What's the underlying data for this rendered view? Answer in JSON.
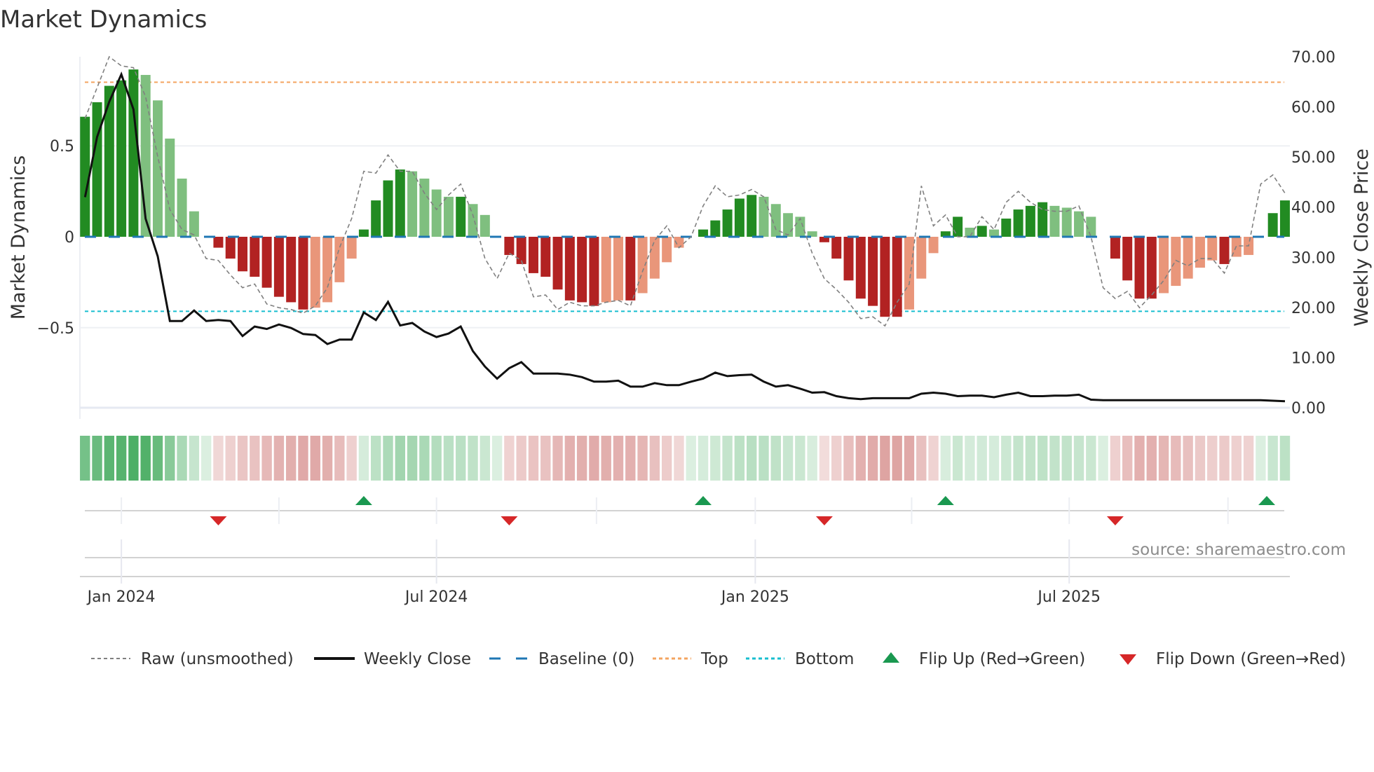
{
  "chart_data": {
    "type": "bar",
    "title": "Market Dynamics",
    "ylabel": "Market Dynamics",
    "y2label": "Weekly Close Price",
    "ylim": [
      -0.94,
      0.99
    ],
    "y2lim": [
      0,
      70
    ],
    "yticks": [
      {
        "v": 0.5,
        "label": "0.5"
      },
      {
        "v": 0,
        "label": "0"
      },
      {
        "v": -0.5,
        "label": "−0.5"
      }
    ],
    "y2ticks": [
      {
        "v": 70,
        "label": "70.00"
      },
      {
        "v": 60,
        "label": "60.00"
      },
      {
        "v": 50,
        "label": "50.00"
      },
      {
        "v": 40,
        "label": "40.00"
      },
      {
        "v": 30,
        "label": "30.00"
      },
      {
        "v": 20,
        "label": "20.00"
      },
      {
        "v": 10,
        "label": "10.00"
      },
      {
        "v": 0,
        "label": "0.00"
      }
    ],
    "xticks": [
      {
        "week": 3,
        "label": "Jan 2024"
      },
      {
        "week": 29,
        "label": "Jul 2024"
      },
      {
        "week": 55.3,
        "label": "Jan 2025"
      },
      {
        "week": 81.2,
        "label": "Jul 2025"
      }
    ],
    "quarter_gridlines_week": [
      3,
      16,
      29,
      42.2,
      55.3,
      68.2,
      81.2,
      94.3
    ],
    "top_level": 0.85,
    "bottom_level": -0.41,
    "baseline": 0,
    "dynamics": [
      0.66,
      0.74,
      0.83,
      0.86,
      0.92,
      0.89,
      0.75,
      0.54,
      0.32,
      0.14,
      0,
      -0.06,
      -0.12,
      -0.19,
      -0.22,
      -0.28,
      -0.33,
      -0.36,
      -0.4,
      -0.39,
      -0.36,
      -0.25,
      -0.12,
      0.04,
      0.2,
      0.31,
      0.37,
      0.36,
      0.32,
      0.26,
      0.22,
      0.22,
      0.18,
      0.12,
      0,
      -0.1,
      -0.15,
      -0.2,
      -0.22,
      -0.29,
      -0.35,
      -0.36,
      -0.38,
      -0.36,
      -0.35,
      -0.35,
      -0.31,
      -0.23,
      -0.14,
      -0.06,
      0,
      0.04,
      0.09,
      0.15,
      0.21,
      0.23,
      0.22,
      0.18,
      0.13,
      0.11,
      0.03,
      -0.03,
      -0.12,
      -0.24,
      -0.34,
      -0.38,
      -0.44,
      -0.44,
      -0.4,
      -0.23,
      -0.09,
      0.03,
      0.11,
      0.05,
      0.06,
      0.04,
      0.1,
      0.15,
      0.17,
      0.19,
      0.17,
      0.16,
      0.14,
      0.11,
      0,
      -0.12,
      -0.24,
      -0.34,
      -0.34,
      -0.31,
      -0.27,
      -0.23,
      -0.17,
      -0.13,
      -0.15,
      -0.11,
      -0.1,
      0,
      0.13,
      0.2
    ],
    "raw": [
      0.65,
      0.82,
      0.99,
      0.94,
      0.93,
      0.77,
      0.44,
      0.15,
      0.04,
      0.01,
      -0.12,
      -0.13,
      -0.21,
      -0.28,
      -0.26,
      -0.37,
      -0.39,
      -0.4,
      -0.42,
      -0.38,
      -0.28,
      -0.06,
      0.1,
      0.36,
      0.35,
      0.45,
      0.36,
      0.36,
      0.24,
      0.15,
      0.23,
      0.29,
      0.12,
      -0.12,
      -0.23,
      -0.09,
      -0.13,
      -0.33,
      -0.32,
      -0.4,
      -0.36,
      -0.38,
      -0.38,
      -0.36,
      -0.35,
      -0.38,
      -0.19,
      -0.02,
      0.06,
      -0.06,
      0.0,
      0.17,
      0.28,
      0.22,
      0.23,
      0.26,
      0.22,
      0.04,
      0.01,
      0.1,
      -0.09,
      -0.23,
      -0.29,
      -0.36,
      -0.45,
      -0.44,
      -0.49,
      -0.36,
      -0.26,
      0.28,
      0.06,
      0.12,
      0.0,
      0.0,
      0.11,
      0.04,
      0.19,
      0.25,
      0.19,
      0.15,
      0.14,
      0.14,
      0.17,
      0.0,
      -0.28,
      -0.34,
      -0.3,
      -0.39,
      -0.32,
      -0.24,
      -0.13,
      -0.16,
      -0.12,
      -0.12,
      -0.2,
      -0.05,
      -0.05,
      0.29,
      0.34,
      0.24
    ],
    "weekly_close": [
      42,
      54,
      61,
      66.5,
      59.5,
      37.7,
      30.2,
      17.3,
      17.3,
      19.4,
      17.3,
      17.5,
      17.3,
      14.3,
      16.2,
      15.7,
      16.6,
      15.9,
      14.7,
      14.5,
      12.7,
      13.6,
      13.6,
      19.0,
      17.5,
      21.1,
      16.4,
      16.9,
      15.2,
      14.1,
      14.8,
      16.2,
      11.3,
      8.2,
      5.8,
      7.9,
      9.1,
      6.8,
      6.8,
      6.8,
      6.6,
      6.1,
      5.2,
      5.2,
      5.4,
      4.2,
      4.2,
      4.9,
      4.5,
      4.5,
      5.2,
      5.8,
      7.0,
      6.3,
      6.5,
      6.6,
      5.2,
      4.2,
      4.5,
      3.8,
      3.0,
      3.1,
      2.3,
      1.9,
      1.7,
      1.9,
      1.9,
      1.9,
      1.9,
      2.8,
      3.0,
      2.8,
      2.3,
      2.4,
      2.4,
      2.1,
      2.6,
      3.0,
      2.3,
      2.3,
      2.4,
      2.4,
      2.6,
      1.6,
      1.5,
      1.5,
      1.5,
      1.5,
      1.5,
      1.5,
      1.5,
      1.5,
      1.5,
      1.5,
      1.5,
      1.5,
      1.5,
      1.5,
      1.4,
      1.3
    ],
    "flip_up_weeks": [
      23,
      51,
      71,
      97.5
    ],
    "flip_down_weeks": [
      11,
      35,
      61,
      85
    ],
    "colors": {
      "up_strong": "#228b22",
      "up_weak": "#7fbf7f",
      "down_strong": "#b22222",
      "down_weak": "#e9967a",
      "raw": "#808080",
      "close": "#111111",
      "baseline": "#1f77b4",
      "top": "#f4a460",
      "bottom": "#17becf",
      "flip_up": "#1a9850",
      "flip_down": "#d62728",
      "strip_green": "#3aa655",
      "strip_red": "#c0504d"
    },
    "legend": {
      "placement": "bottom",
      "items": [
        {
          "key": "raw",
          "label": "Raw (unsmoothed)"
        },
        {
          "key": "close",
          "label": "Weekly Close"
        },
        {
          "key": "baseline",
          "label": "Baseline (0)"
        },
        {
          "key": "top",
          "label": "Top"
        },
        {
          "key": "bottom",
          "label": "Bottom"
        },
        {
          "key": "flip_up",
          "label": "Flip Up (Red→Green)"
        },
        {
          "key": "flip_down",
          "label": "Flip Down (Green→Red)"
        }
      ]
    },
    "source": "source: sharemaestro.com"
  }
}
